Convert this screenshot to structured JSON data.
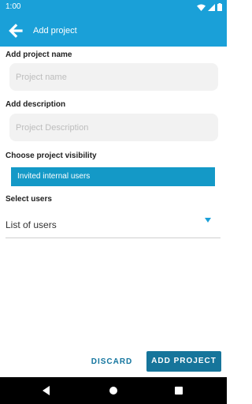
{
  "status_bar": {
    "time": "1:00",
    "icons": [
      "wifi-icon",
      "signal-icon",
      "battery-icon"
    ]
  },
  "app_bar": {
    "title": "Add project",
    "back_icon": "arrow-back-icon",
    "background": "#1aa0d8"
  },
  "form": {
    "name_label": "Add project name",
    "name_value": "",
    "name_placeholder": "Project name",
    "description_label": "Add description",
    "description_value": "",
    "description_placeholder": "Project Description",
    "visibility_label": "Choose project visibility",
    "visibility_selected": "Invited internal users",
    "users_label": "Select users",
    "users_selected": "List of users"
  },
  "actions": {
    "discard_label": "DISCARD",
    "add_label": "ADD PROJECT",
    "accent": "#16759b"
  },
  "nav_bar": {
    "icons": [
      "nav-back-icon",
      "nav-home-icon",
      "nav-recents-icon"
    ]
  }
}
